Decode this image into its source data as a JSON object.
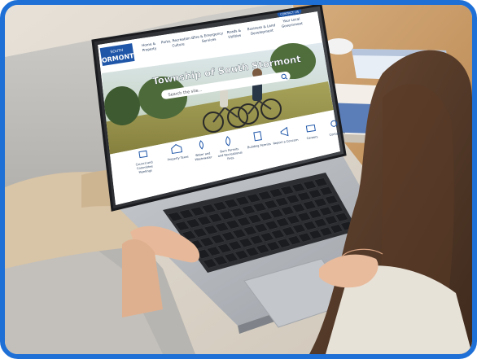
{
  "scene": {
    "frame_color": "#1e6fd6",
    "description_colors": {
      "sofa": "#c9c6c1",
      "table": "#c89a6a",
      "laptop": "#b8bcc2",
      "screen_header": "#ffffff",
      "brand_blue": "#1f56a8"
    }
  },
  "website": {
    "logo_top": "SOUTH",
    "logo_bottom": "ORMONT",
    "nav": [
      {
        "line1": "Home &",
        "line2": "Property"
      },
      {
        "line1": "Parks, Recreation &",
        "line2": "Culture"
      },
      {
        "line1": "Fire & Emergency",
        "line2": "Services"
      },
      {
        "line1": "Roads &",
        "line2": "Utilities"
      },
      {
        "line1": "Business & Land",
        "line2": "Development"
      },
      {
        "line1": "Your Local",
        "line2": "Government"
      }
    ],
    "contact_button": "CONTACT US",
    "hero_title": "Township of South Stormont",
    "search_placeholder": "Search the site...",
    "quick_links": [
      {
        "line1": "Council and",
        "line2": "Committee",
        "line3": "Meetings"
      },
      {
        "line1": "Property Taxes",
        "line2": "",
        "line3": ""
      },
      {
        "line1": "Water and",
        "line2": "Wastewater",
        "line3": ""
      },
      {
        "line1": "Burn Permits",
        "line2": "and Recreational",
        "line3": "Fires"
      },
      {
        "line1": "Building Permits",
        "line2": "",
        "line3": ""
      },
      {
        "line1": "Report a Concern",
        "line2": "",
        "line3": ""
      },
      {
        "line1": "Careers",
        "line2": "",
        "line3": ""
      },
      {
        "line1": "Contact Us",
        "line2": "",
        "line3": ""
      }
    ]
  }
}
